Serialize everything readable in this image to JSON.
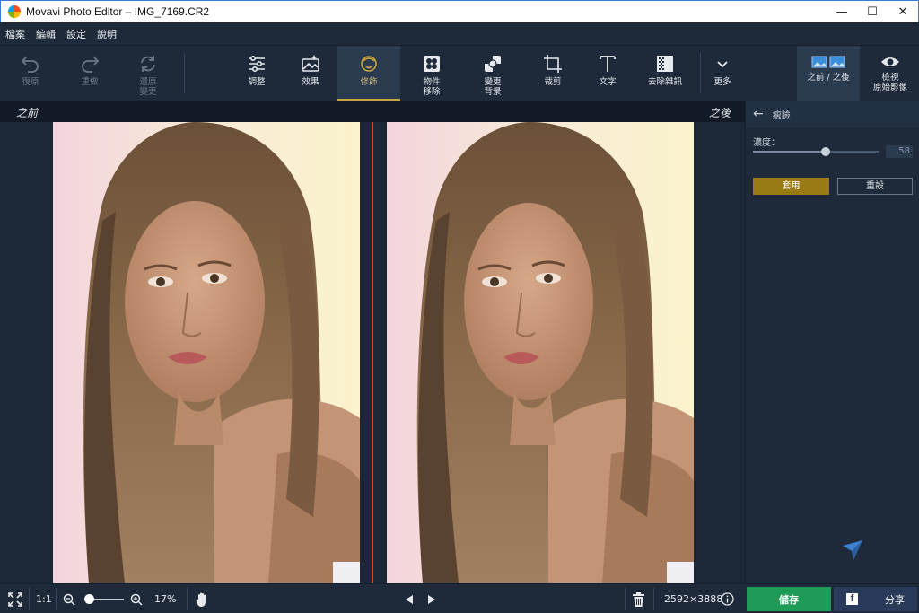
{
  "window": {
    "title": "Movavi Photo Editor – IMG_7169.CR2",
    "minimize": "—",
    "maximize": "☐",
    "close": "✕"
  },
  "menu": [
    "檔案",
    "編輯",
    "設定",
    "說明"
  ],
  "toolbar": {
    "undo": "復原",
    "redo": "重做",
    "restore": "還原\n變更",
    "adjust": "調整",
    "effects": "效果",
    "retouch": "修飾",
    "object_removal": "物件\n移除",
    "change_background": "變更\n背景",
    "crop": "裁剪",
    "text": "文字",
    "denoise": "去除雜訊",
    "more": "更多"
  },
  "view_toolbar": {
    "before_after": "之前 / 之後",
    "view_original": "檢視\n原始影像"
  },
  "canvas": {
    "before_label": "之前",
    "after_label": "之後"
  },
  "panel": {
    "title": "瘦臉",
    "slider_label": "濃度：",
    "slider_value": "58",
    "slider_fraction": 0.58,
    "apply_button": "套用",
    "reset_button": "重設"
  },
  "bottom": {
    "zoom_1to1": "1:1",
    "zoom_percent": "17%",
    "zoom_fraction": 0.1,
    "dimensions": "2592×3888",
    "save": "儲存",
    "share": "分享"
  },
  "colors": {
    "accent_gold": "#c9a53e",
    "apply_button": "#9a7a14",
    "save_green": "#1e9b56",
    "split_line": "#e0472b"
  }
}
